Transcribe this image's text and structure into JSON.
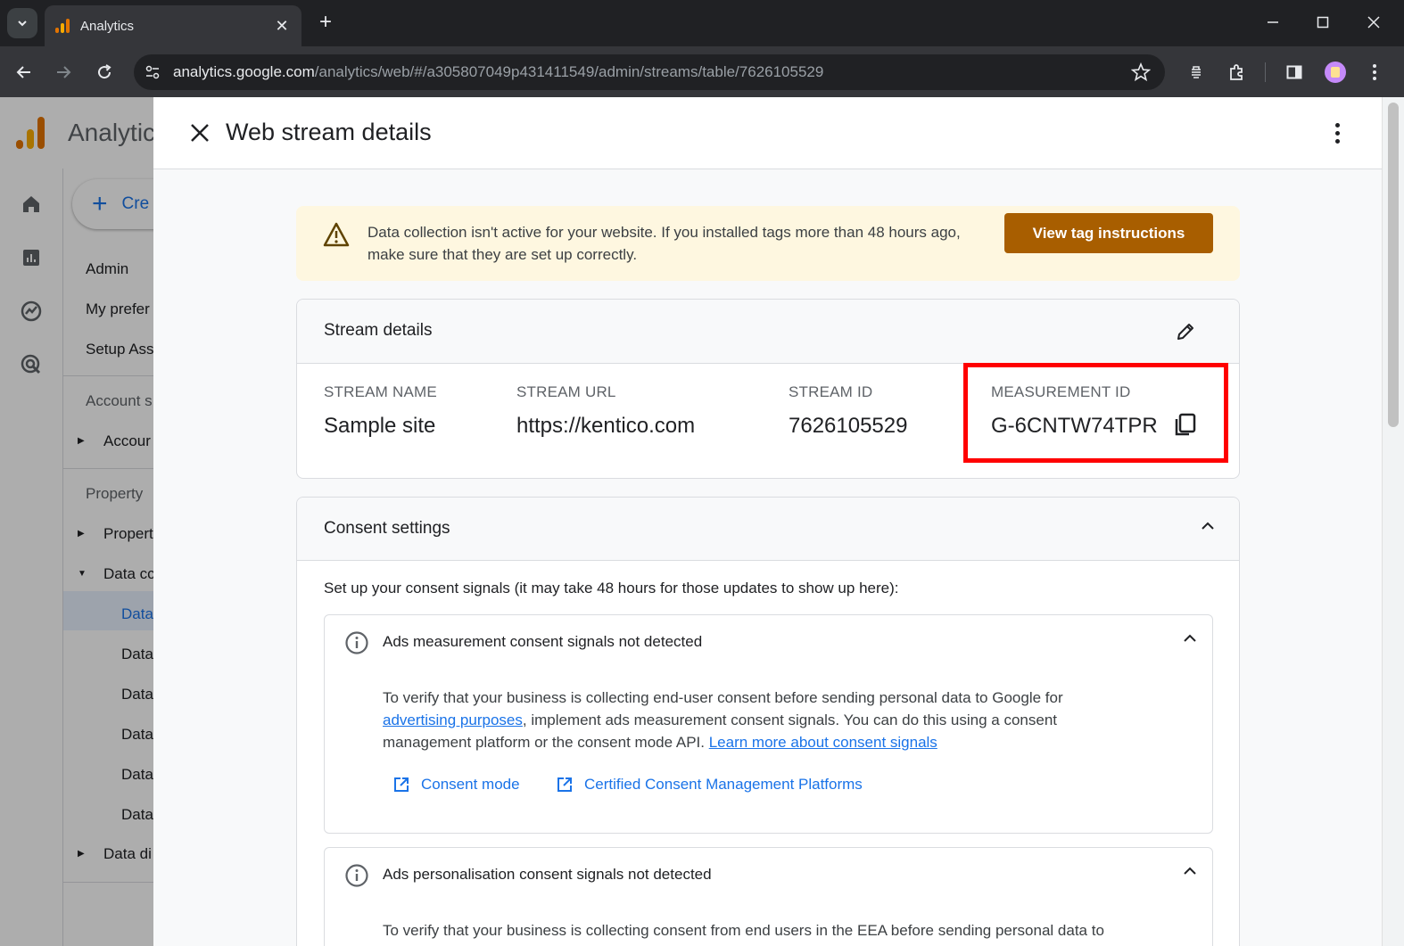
{
  "browser": {
    "tab_title": "Analytics",
    "url_host": "analytics.google.com",
    "url_path": "/analytics/web/#/a305807049p431411549/admin/streams/table/7626105529"
  },
  "app": {
    "name": "Analytics",
    "create_label": "Cre",
    "nav": {
      "admin": "Admin",
      "my_prefs": "My prefer",
      "setup_assistant": "Setup Ass",
      "account_section": "Account s",
      "account_item": "Accour",
      "property_section": "Property",
      "property_item": "Propert",
      "data_collection": "Data cc",
      "data_streams": "Data",
      "sub1": "Data",
      "sub2": "Data",
      "sub3": "Data",
      "sub4": "Data",
      "sub5": "Data",
      "data_display": "Data di"
    }
  },
  "drawer": {
    "title": "Web stream details",
    "banner": {
      "text": "Data collection isn't active for your website. If you installed tags more than 48 hours ago, make sure that they are set up correctly.",
      "button": "View tag instructions"
    },
    "stream_details": {
      "title": "Stream details",
      "stream_name_label": "STREAM NAME",
      "stream_name": "Sample site",
      "stream_url_label": "STREAM URL",
      "stream_url": "https://kentico.com",
      "stream_id_label": "STREAM ID",
      "stream_id": "7626105529",
      "measurement_id_label": "MEASUREMENT ID",
      "measurement_id": "G-6CNTW74TPR"
    },
    "consent": {
      "title": "Consent settings",
      "intro": "Set up your consent signals (it may take 48 hours for those updates to show up here):",
      "ads_measurement": {
        "title": "Ads measurement consent signals not detected",
        "body_1": "To verify that your business is collecting end-user consent before sending personal data to Google for ",
        "link_1": "advertising purposes",
        "body_2": ", implement ads measurement consent signals. You can do this using a consent management platform or the consent mode API. ",
        "link_2": "Learn more about consent signals",
        "consent_mode": "Consent mode",
        "cmp": "Certified Consent Management Platforms"
      },
      "ads_personalisation": {
        "title": "Ads personalisation consent signals not detected",
        "body": "To verify that your business is collecting consent from end users in the EEA before sending personal data to"
      }
    }
  },
  "colors": {
    "accent": "#1a73e8",
    "warning_button": "#a85e00",
    "banner_bg": "#fef7e0",
    "highlight": "#ff0000"
  },
  "icons": [
    "chevron-down-icon",
    "close-icon",
    "plus-icon",
    "back-icon",
    "forward-icon",
    "reload-icon",
    "site-info-icon",
    "star-icon",
    "extension-icon",
    "sidepanel-icon",
    "profile-icon",
    "menu-icon",
    "home-icon",
    "reports-icon",
    "explore-icon",
    "advertising-icon",
    "gear-icon",
    "kebab-icon",
    "warning-icon",
    "pencil-icon",
    "copy-icon",
    "chevron-up-icon",
    "info-icon",
    "open-in-new-icon"
  ]
}
